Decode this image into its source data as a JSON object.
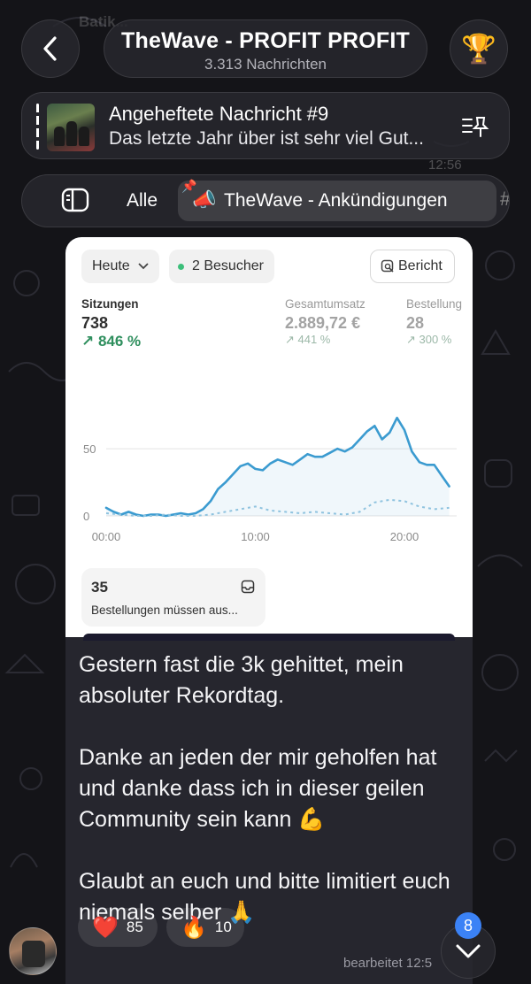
{
  "header": {
    "title": "TheWave - PROFIT PROFIT",
    "subtitle": "3.313 Nachrichten",
    "background_sender": "Batik...",
    "trophy_icon": "trophy-icon"
  },
  "pinned": {
    "title": "Angeheftete Nachricht #9",
    "preview": "Das letzte Jahr über ist sehr viel Gut...",
    "ghost_time": "12:56"
  },
  "filters": {
    "all_label": "Alle",
    "active_label": "TheWave - Ankündigungen",
    "active_emoji": "📣",
    "more_label": "#"
  },
  "dashboard": {
    "date_chip": "Heute",
    "visitors_chip": "2 Besucher",
    "report_button": "Bericht",
    "metrics": [
      {
        "label": "Sitzungen",
        "value": "738",
        "change": "↗ 846 %"
      },
      {
        "label": "Gesamtumsatz",
        "value": "2.889,72 €",
        "change": "↗ 441 %"
      },
      {
        "label": "Bestellung",
        "value": "28",
        "change": "↗ 300 %"
      }
    ],
    "orders_count": "35",
    "orders_label": "Bestellungen müssen aus..."
  },
  "chart_data": {
    "type": "line",
    "x_ticks": [
      "00:00",
      "10:00",
      "20:00"
    ],
    "y_ticks": [
      "0",
      "50"
    ],
    "ylim": [
      0,
      85
    ],
    "xlim": [
      0,
      23.5
    ],
    "grid": true,
    "series": [
      {
        "style": "solid",
        "color": "#3b9bd0",
        "x": [
          0,
          0.5,
          1,
          1.5,
          2,
          2.5,
          3,
          3.5,
          4,
          4.5,
          5,
          5.5,
          6,
          6.5,
          7,
          7.5,
          8,
          8.5,
          9,
          9.5,
          10,
          10.5,
          11,
          11.5,
          12,
          12.5,
          13,
          13.5,
          14,
          14.5,
          15,
          15.5,
          16,
          16.5,
          17,
          17.5,
          18,
          18.5,
          19,
          19.5,
          20,
          20.5,
          21,
          21.5,
          22,
          22.5,
          23
        ],
        "y": [
          6,
          3,
          1,
          3,
          1,
          0,
          1,
          1,
          0,
          1,
          2,
          1,
          2,
          5,
          11,
          20,
          25,
          31,
          37,
          39,
          35,
          34,
          39,
          42,
          40,
          38,
          42,
          46,
          44,
          44,
          47,
          50,
          48,
          51,
          57,
          63,
          67,
          57,
          62,
          73,
          64,
          48,
          40,
          38,
          38,
          30,
          22
        ]
      },
      {
        "style": "dashed",
        "color": "#8fc3df",
        "x": [
          0,
          1,
          2,
          3,
          4,
          5,
          6,
          7,
          8,
          9,
          10,
          11,
          12,
          13,
          14,
          15,
          16,
          17,
          18,
          19,
          20,
          21,
          22,
          23
        ],
        "y": [
          2,
          1,
          0,
          0,
          1,
          0,
          0,
          1,
          3,
          5,
          7,
          4,
          3,
          2,
          3,
          2,
          1,
          3,
          10,
          12,
          11,
          7,
          5,
          6
        ]
      }
    ]
  },
  "message": {
    "paragraphs": [
      "Gestern fast die 3k gehittet, mein absoluter Rekordtag.",
      "Danke an jeden der mir geholfen hat und danke dass ich in dieser geilen Community sein kann 💪",
      "Glaubt an euch und bitte limitiert euch niemals selber 🙏"
    ],
    "reactions": [
      {
        "emoji": "❤️",
        "count": "85"
      },
      {
        "emoji": "🔥",
        "count": "10"
      }
    ],
    "edited_label": "bearbeitet 12:5"
  },
  "scroll": {
    "unread_badge": "8"
  },
  "colors": {
    "background": "#141418",
    "bubble": "#26262e",
    "accent_green": "#2f8f5e",
    "chart_line": "#3b9bd0",
    "badge": "#3b82f6"
  }
}
